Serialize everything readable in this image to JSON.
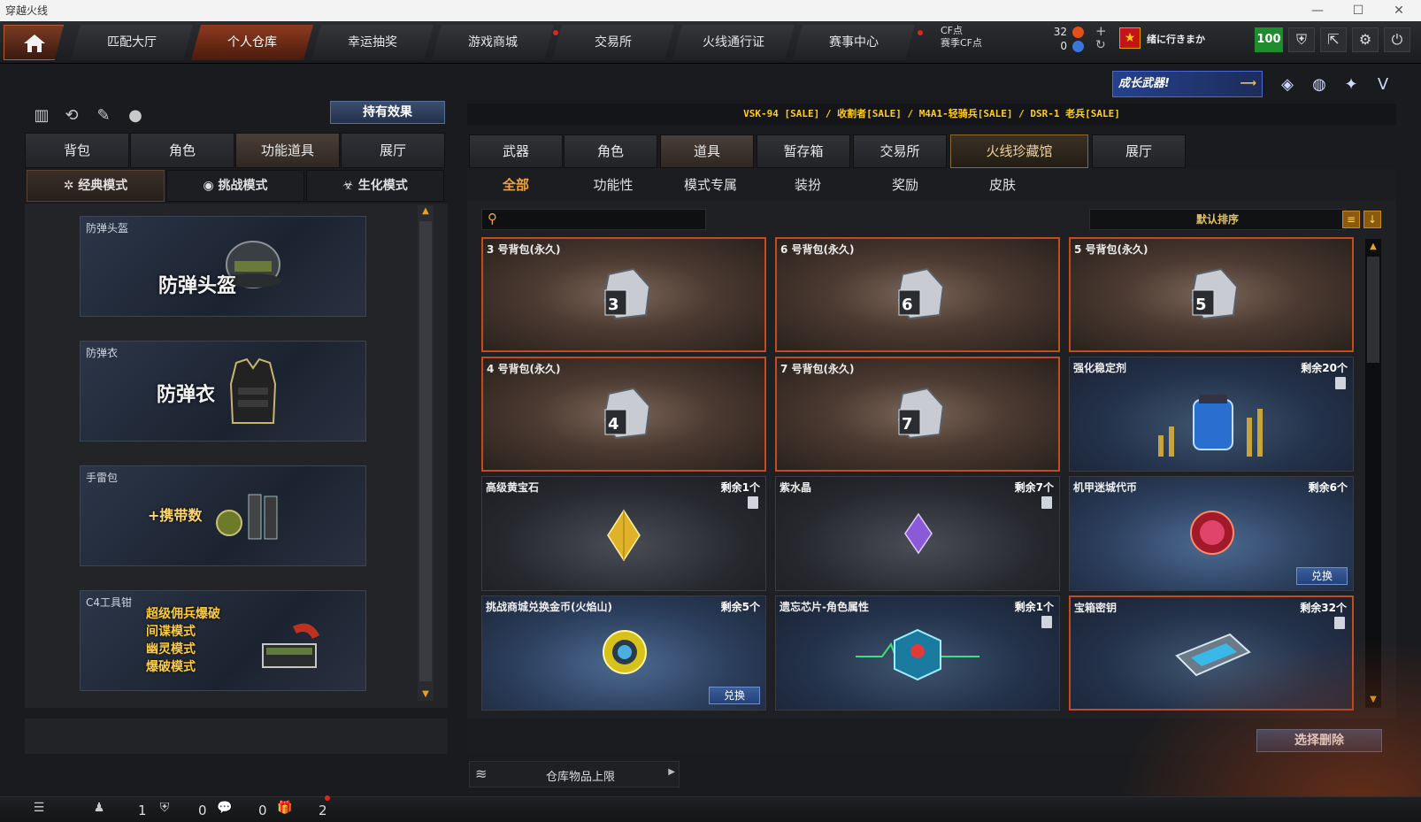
{
  "window": {
    "title": "穿越火线"
  },
  "nav": {
    "tabs": [
      {
        "label": "匹配大厅"
      },
      {
        "label": "个人仓库",
        "active": true
      },
      {
        "label": "幸运抽奖"
      },
      {
        "label": "游戏商城",
        "dot": true
      },
      {
        "label": "交易所"
      },
      {
        "label": "火线通行证"
      },
      {
        "label": "赛事中心",
        "dot": true
      }
    ]
  },
  "currency": {
    "cf_label": "CF点",
    "season_cf_label": "赛季CF点",
    "cf_value": "32",
    "season_cf_value": "0"
  },
  "player": {
    "name": "绪に行きまか",
    "level": "100"
  },
  "left": {
    "effect_button": "持有效果",
    "tabs": [
      "背包",
      "角色",
      "功能道具",
      "展厅"
    ],
    "active_tab": "功能道具",
    "modes": [
      "经典模式",
      "挑战模式",
      "生化模式"
    ],
    "cards": [
      {
        "title": "防弹头盔",
        "big": "防弹头盔"
      },
      {
        "title": "防弹衣",
        "big": "防弹衣"
      },
      {
        "title": "手雷包",
        "big": "+携带数"
      },
      {
        "title": "C4工具钳",
        "lines": [
          "超级佣兵爆破",
          "间谍模式",
          "幽灵模式",
          "爆破模式"
        ]
      }
    ]
  },
  "right": {
    "banner": "成长武器!",
    "ticker": "VSK-94  [SALE] / 收割者[SALE] / M4A1-轻骑兵[SALE] / DSR-1 老兵[SALE]",
    "tabs": [
      "武器",
      "角色",
      "道具",
      "暂存箱",
      "交易所",
      "火线珍藏馆",
      "展厅"
    ],
    "active_tab": "道具",
    "subtabs": [
      "全部",
      "功能性",
      "模式专属",
      "装扮",
      "奖励",
      "皮肤"
    ],
    "active_subtab": "全部",
    "search_placeholder": "",
    "sort_label": "默认排序",
    "items": [
      {
        "name": "3 号背包(永久)",
        "qty": "",
        "num": "3"
      },
      {
        "name": "6 号背包(永久)",
        "qty": "",
        "num": "6"
      },
      {
        "name": "5 号背包(永久)",
        "qty": "",
        "num": "5"
      },
      {
        "name": "4 号背包(永久)",
        "qty": "",
        "num": "4"
      },
      {
        "name": "7 号背包(永久)",
        "qty": "",
        "num": "7"
      },
      {
        "name": "强化稳定剂",
        "qty": "剩余20个"
      },
      {
        "name": "高级黄宝石",
        "qty": "剩余1个"
      },
      {
        "name": "紫水晶",
        "qty": "剩余7个"
      },
      {
        "name": "机甲迷城代币",
        "qty": "剩余6个",
        "button": "兑换"
      },
      {
        "name": "挑战商城兑换金币(火焰山)",
        "qty": "剩余5个",
        "button": "兑换"
      },
      {
        "name": "遗忘芯片-角色属性",
        "qty": "剩余1个"
      },
      {
        "name": "宝箱密钥",
        "qty": "剩余32个"
      }
    ],
    "delete_button": "选择删除",
    "storage_limit": "仓库物品上限"
  },
  "status": {
    "v1": "1",
    "v2": "0",
    "v3": "0",
    "v4": "2"
  },
  "colors": {
    "accent": "#c14c23",
    "gold": "#f0a33a",
    "level_green": "#1f8d2e"
  }
}
